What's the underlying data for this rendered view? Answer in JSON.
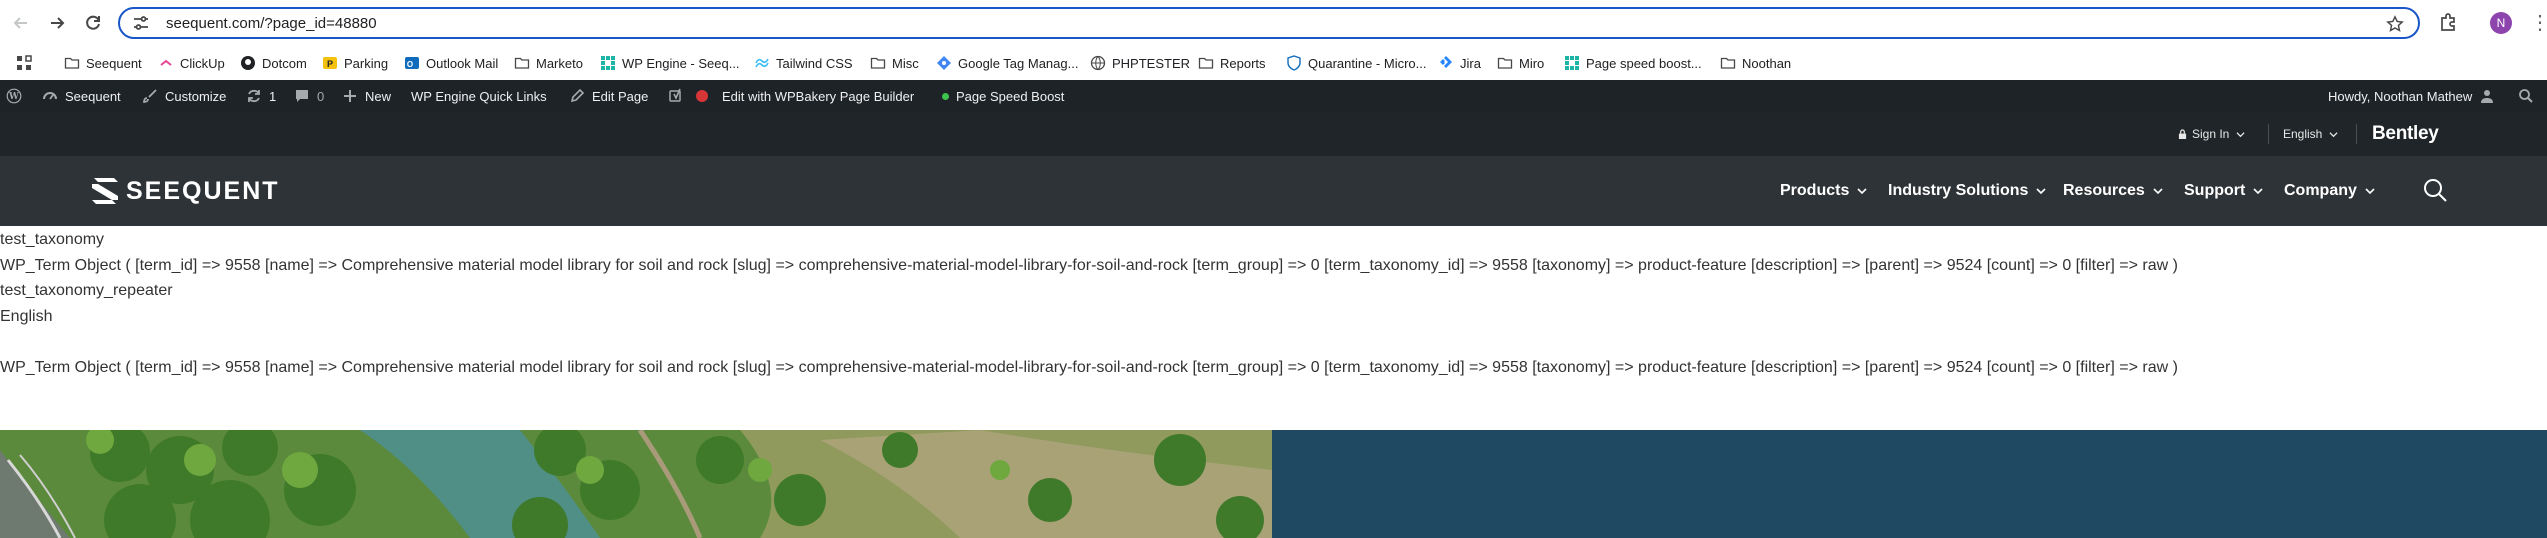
{
  "browser": {
    "url": "seequent.com/?page_id=48880",
    "profile_initial": "N"
  },
  "bookmarks": [
    {
      "label": "Seequent",
      "icon": "folder-icon"
    },
    {
      "label": "ClickUp",
      "icon": "clickup-icon"
    },
    {
      "label": "Dotcom",
      "icon": "github-icon"
    },
    {
      "label": "Parking",
      "icon": "parking-icon"
    },
    {
      "label": "Outlook Mail",
      "icon": "outlook-icon"
    },
    {
      "label": "Marketo",
      "icon": "folder-icon"
    },
    {
      "label": "WP Engine - Seeq...",
      "icon": "wpengine-icon"
    },
    {
      "label": "Tailwind CSS",
      "icon": "tailwind-icon"
    },
    {
      "label": "Misc",
      "icon": "folder-icon"
    },
    {
      "label": "Google Tag Manag...",
      "icon": "gtm-icon"
    },
    {
      "label": "PHPTESTER",
      "icon": "globe-icon"
    },
    {
      "label": "Reports",
      "icon": "folder-icon"
    },
    {
      "label": "Quarantine - Micro...",
      "icon": "shield-icon"
    },
    {
      "label": "Jira",
      "icon": "jira-icon"
    },
    {
      "label": "Miro",
      "icon": "folder-icon"
    },
    {
      "label": "Page speed boost...",
      "icon": "wpengine-icon"
    },
    {
      "label": "Noothan",
      "icon": "folder-icon"
    }
  ],
  "wp_admin": {
    "site_name": "Seequent",
    "customize": "Customize",
    "updates_count": "1",
    "comments_count": "0",
    "new": "New",
    "quick_links": "WP Engine Quick Links",
    "edit_page": "Edit Page",
    "wpbakery": "Edit with WPBakery Page Builder",
    "page_speed": "Page Speed Boost",
    "howdy": "Howdy, Noothan Mathew"
  },
  "site": {
    "sign_in": "Sign In",
    "language": "English",
    "bentley": "Bentley",
    "logo_text": "SEEQUENT",
    "nav": [
      "Products",
      "Industry Solutions",
      "Resources",
      "Support",
      "Company"
    ]
  },
  "debug_lines": [
    "test_taxonomy",
    "WP_Term Object ( [term_id] => 9558 [name] => Comprehensive material model library for soil and rock [slug] => comprehensive-material-model-library-for-soil-and-rock [term_group] => 0 [term_taxonomy_id] => 9558 [taxonomy] => product-feature [description] => [parent] => 9524 [count] => 0 [filter] => raw )",
    "test_taxonomy_repeater",
    "English",
    "",
    "WP_Term Object ( [term_id] => 9558 [name] => Comprehensive material model library for soil and rock [slug] => comprehensive-material-model-library-for-soil-and-rock [term_group] => 0 [term_taxonomy_id] => 9558 [taxonomy] => product-feature [description] => [parent] => 9524 [count] => 0 [filter] => raw )"
  ],
  "colors": {
    "address_border": "#1a56c8",
    "wp_bar": "#1d2327",
    "site_header": "#2d3337",
    "hero_blue": "#1f4862",
    "record_dot": "#d63638",
    "speed_dot": "#3ec14d"
  }
}
